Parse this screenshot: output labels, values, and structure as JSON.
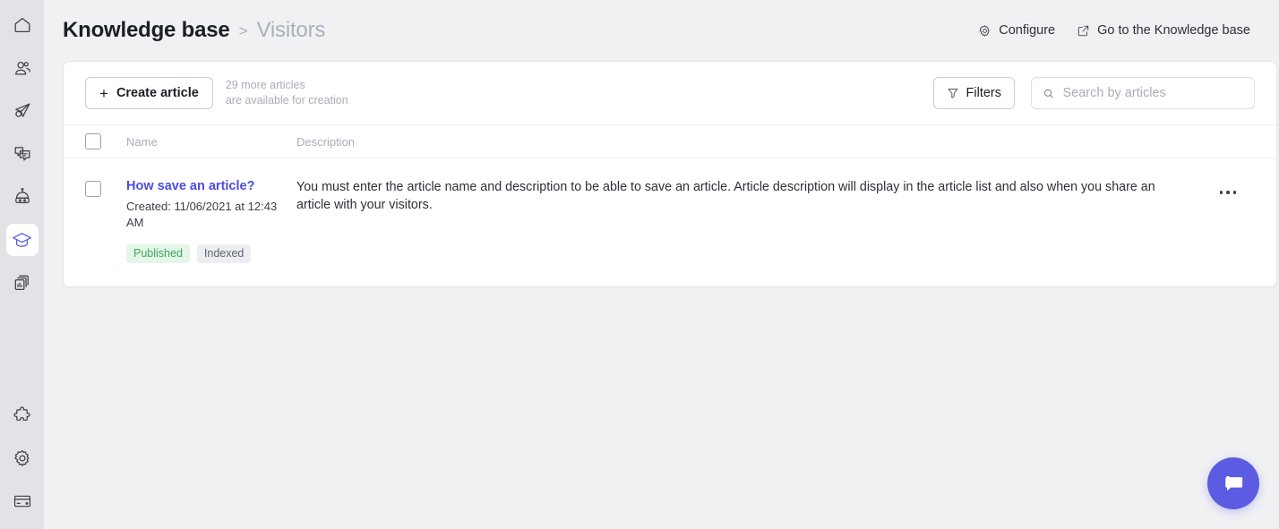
{
  "sidebar": {
    "top_items": [
      {
        "name": "home",
        "icon": "home-icon",
        "active": false
      },
      {
        "name": "contacts",
        "icon": "users-icon",
        "active": false
      },
      {
        "name": "campaigns",
        "icon": "paper-plane-icon",
        "active": false
      },
      {
        "name": "chats",
        "icon": "chat-bubbles-icon",
        "active": false
      },
      {
        "name": "bots",
        "icon": "robot-icon",
        "active": false
      },
      {
        "name": "knowledge-base",
        "icon": "graduation-cap-icon",
        "active": true
      },
      {
        "name": "reports",
        "icon": "reports-icon",
        "active": false
      }
    ],
    "bottom_items": [
      {
        "name": "apps",
        "icon": "puzzle-icon",
        "active": false
      },
      {
        "name": "settings",
        "icon": "gear-icon",
        "active": false
      },
      {
        "name": "billing",
        "icon": "credit-card-icon",
        "active": false
      }
    ]
  },
  "breadcrumb": {
    "root": "Knowledge base",
    "separator": ">",
    "current": "Visitors"
  },
  "top_actions": {
    "configure": "Configure",
    "go_to_kb": "Go to the Knowledge base"
  },
  "toolbar": {
    "create_label": "Create article",
    "create_plus": "+",
    "more_line1": "29 more articles",
    "more_line2": "are available for creation",
    "filters_label": "Filters"
  },
  "search": {
    "placeholder": "Search by articles",
    "value": ""
  },
  "table": {
    "headers": {
      "name": "Name",
      "description": "Description"
    },
    "rows": [
      {
        "title": "How save an article?",
        "created": "Created: 11/06/2021 at 12:43 AM",
        "badges": [
          {
            "label": "Published",
            "kind": "published"
          },
          {
            "label": "Indexed",
            "kind": "indexed"
          }
        ],
        "description": "You must enter the article name and description to be able to save an article. Article description will display in the article list and also when you share an article with your visitors."
      }
    ]
  },
  "chat_widget": {
    "icon": "chat-bubble-icon"
  },
  "colors": {
    "accent": "#5b5ce2",
    "link": "#4b4de0",
    "page_bg": "#f0f1f3",
    "sidebar_bg": "#e2e3e7",
    "badge_published_bg": "#e3f6e8",
    "badge_published_text": "#3fa563",
    "badge_indexed_bg": "#edeef1",
    "badge_indexed_text": "#5d636e"
  }
}
